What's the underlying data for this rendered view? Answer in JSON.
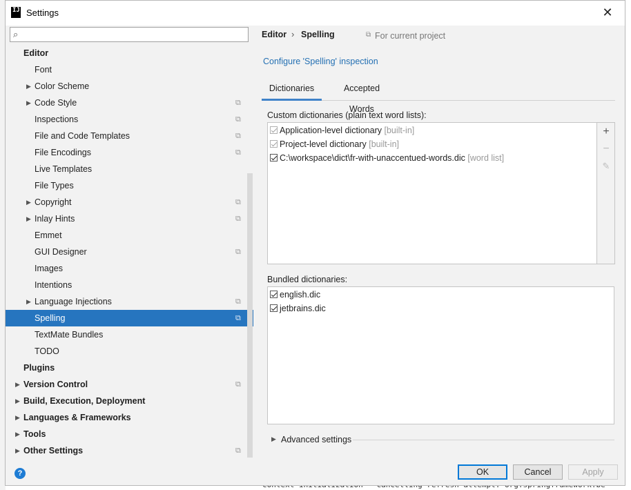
{
  "window": {
    "title": "Settings",
    "close_glyph": "✕"
  },
  "search": {
    "placeholder": "",
    "icon": "search-icon"
  },
  "tree": {
    "items": [
      {
        "label": "Editor",
        "level": 0,
        "bold": true,
        "arrow": false,
        "copy": false,
        "selected": false
      },
      {
        "label": "Font",
        "level": 1,
        "arrow": false,
        "copy": false
      },
      {
        "label": "Color Scheme",
        "level": 1,
        "arrow": true,
        "copy": false
      },
      {
        "label": "Code Style",
        "level": 1,
        "arrow": true,
        "copy": true
      },
      {
        "label": "Inspections",
        "level": 1,
        "arrow": false,
        "copy": true
      },
      {
        "label": "File and Code Templates",
        "level": 1,
        "arrow": false,
        "copy": true
      },
      {
        "label": "File Encodings",
        "level": 1,
        "arrow": false,
        "copy": true
      },
      {
        "label": "Live Templates",
        "level": 1,
        "arrow": false,
        "copy": false
      },
      {
        "label": "File Types",
        "level": 1,
        "arrow": false,
        "copy": false
      },
      {
        "label": "Copyright",
        "level": 1,
        "arrow": true,
        "copy": true
      },
      {
        "label": "Inlay Hints",
        "level": 1,
        "arrow": true,
        "copy": true
      },
      {
        "label": "Emmet",
        "level": 1,
        "arrow": false,
        "copy": false
      },
      {
        "label": "GUI Designer",
        "level": 1,
        "arrow": false,
        "copy": true
      },
      {
        "label": "Images",
        "level": 1,
        "arrow": false,
        "copy": false
      },
      {
        "label": "Intentions",
        "level": 1,
        "arrow": false,
        "copy": false
      },
      {
        "label": "Language Injections",
        "level": 1,
        "arrow": true,
        "copy": true
      },
      {
        "label": "Spelling",
        "level": 1,
        "arrow": false,
        "copy": true,
        "selected": true
      },
      {
        "label": "TextMate Bundles",
        "level": 1,
        "arrow": false,
        "copy": false
      },
      {
        "label": "TODO",
        "level": 1,
        "arrow": false,
        "copy": false
      },
      {
        "label": "Plugins",
        "level": 0,
        "bold": true,
        "arrow": false,
        "copy": false
      },
      {
        "label": "Version Control",
        "level": 0,
        "bold": true,
        "arrow": true,
        "copy": true
      },
      {
        "label": "Build, Execution, Deployment",
        "level": 0,
        "bold": true,
        "arrow": true,
        "copy": false
      },
      {
        "label": "Languages & Frameworks",
        "level": 0,
        "bold": true,
        "arrow": true,
        "copy": false
      },
      {
        "label": "Tools",
        "level": 0,
        "bold": true,
        "arrow": true,
        "copy": false
      },
      {
        "label": "Other Settings",
        "level": 0,
        "bold": true,
        "arrow": true,
        "copy": true
      }
    ]
  },
  "breadcrumb": {
    "parent": "Editor",
    "separator": "›",
    "current": "Spelling",
    "scope": "For current project"
  },
  "config_link": "Configure 'Spelling' inspection",
  "tabs": [
    {
      "label": "Dictionaries",
      "active": true
    },
    {
      "label": "Accepted Words",
      "active": false
    }
  ],
  "custom_dictionaries": {
    "label": "Custom dictionaries (plain text word lists):",
    "items": [
      {
        "name": "Application-level dictionary",
        "tag": "[built-in]",
        "checked": true,
        "disabled": true
      },
      {
        "name": "Project-level dictionary",
        "tag": "[built-in]",
        "checked": true,
        "disabled": true
      },
      {
        "name": "C:\\workspace\\dict\\fr-with-unaccentued-words.dic",
        "tag": "[word list]",
        "checked": true,
        "disabled": false
      }
    ],
    "tools": {
      "add": "+",
      "remove": "−",
      "edit": "✎"
    }
  },
  "bundled_dictionaries": {
    "label": "Bundled dictionaries:",
    "items": [
      {
        "name": "english.dic",
        "checked": true
      },
      {
        "name": "jetbrains.dic",
        "checked": true
      }
    ]
  },
  "advanced": {
    "label": "Advanced settings"
  },
  "footer": {
    "help": "?",
    "ok": "OK",
    "cancel": "Cancel",
    "apply": "Apply"
  },
  "background": {
    "bottom_text": "context initialization - cancelling refresh attempt: org.springframework.be"
  },
  "colors": {
    "selection": "#2675bf",
    "link": "#2470b3",
    "tab_underline": "#4083c9",
    "help": "#1e7cd4"
  }
}
